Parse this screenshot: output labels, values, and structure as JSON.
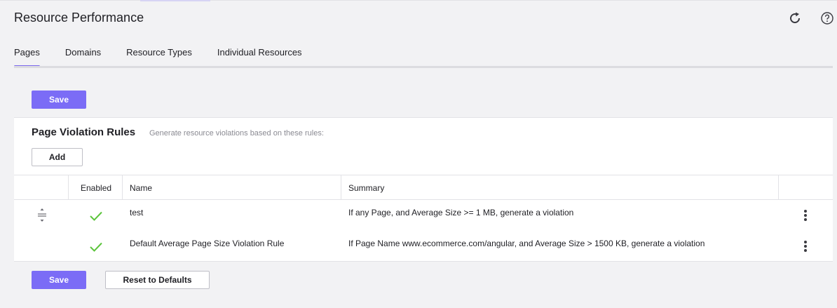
{
  "app": {
    "title": "Resource Performance"
  },
  "header": {
    "icons": [
      "refresh-icon",
      "help-icon"
    ]
  },
  "tabs": [
    {
      "label": "Pages",
      "active": true
    },
    {
      "label": "Domains",
      "active": false
    },
    {
      "label": "Resource Types",
      "active": false
    },
    {
      "label": "Individual Resources",
      "active": false
    }
  ],
  "actions": {
    "save_label": "Save",
    "add_label": "Add",
    "reset_label": "Reset to Defaults"
  },
  "section": {
    "title": "Page Violation Rules",
    "subtitle": "Generate resource violations based on these rules:"
  },
  "table": {
    "columns": [
      "",
      "Enabled",
      "Name",
      "Summary",
      ""
    ],
    "rows": [
      {
        "draggable": true,
        "enabled": true,
        "name": "test",
        "summary": "If any Page, and Average Size >= 1 MB, generate a violation"
      },
      {
        "draggable": false,
        "enabled": true,
        "name": "Default Average Page Size Violation Rule",
        "summary": "If Page Name www.ecommerce.com/angular, and Average Size > 1500 KB, generate a violation"
      }
    ]
  },
  "colors": {
    "accent": "#7b6cf6",
    "check": "#5cc43c",
    "background": "#f2f2f4"
  }
}
